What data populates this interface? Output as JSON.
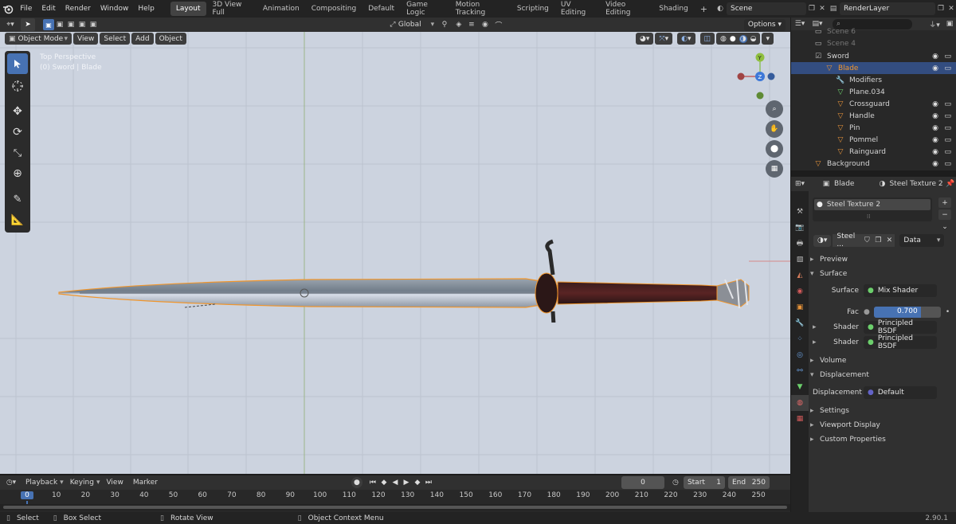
{
  "topbar": {
    "menus": [
      "File",
      "Edit",
      "Render",
      "Window",
      "Help"
    ],
    "workspaces": [
      "Layout",
      "3D View Full",
      "Animation",
      "Compositing",
      "Default",
      "Game Logic",
      "Motion Tracking",
      "Scripting",
      "UV Editing",
      "Video Editing",
      "Shading"
    ],
    "active_workspace": "Layout",
    "add_workspace": "+",
    "scene": "Scene",
    "view_layer": "RenderLayer"
  },
  "viewport_header": {
    "transform_orientation": "Global",
    "options": "Options",
    "mode": "Object Mode",
    "menus": [
      "View",
      "Select",
      "Add",
      "Object"
    ]
  },
  "viewport": {
    "view_name": "Top Perspective",
    "object_info": "(0) Sword | Blade",
    "gizmo_y": "Y",
    "gizmo_z": "Z"
  },
  "outliner": {
    "rows": [
      {
        "name": "Scene 6",
        "indent": 1
      },
      {
        "name": "Scene 4",
        "indent": 1
      },
      {
        "name": "Sword",
        "indent": 1
      },
      {
        "name": "Blade",
        "indent": 2
      },
      {
        "name": "Modifiers",
        "indent": 3
      },
      {
        "name": "Plane.034",
        "indent": 3
      },
      {
        "name": "Crossguard",
        "indent": 3
      },
      {
        "name": "Handle",
        "indent": 3
      },
      {
        "name": "Pin",
        "indent": 3
      },
      {
        "name": "Pommel",
        "indent": 3
      },
      {
        "name": "Rainguard",
        "indent": 3
      },
      {
        "name": "Background",
        "indent": 1
      }
    ]
  },
  "properties": {
    "object": "Blade",
    "material": "Steel Texture 2",
    "slot_name": "Steel Texture 2",
    "mat_short": "Steel ...",
    "link": "Data",
    "sections": {
      "preview": "Preview",
      "surface": "Surface",
      "volume": "Volume",
      "displacement": "Displacement",
      "settings": "Settings",
      "viewport_display": "Viewport Display",
      "custom_props": "Custom Properties"
    },
    "surface_label": "Surface",
    "surface_value": "Mix Shader",
    "fac_label": "Fac",
    "fac_value": "0.700",
    "fac_fraction": 0.7,
    "shader_label": "Shader",
    "shader1": "Principled BSDF",
    "shader2": "Principled BSDF",
    "disp_label": "Displacement",
    "disp_value": "Default"
  },
  "timeline": {
    "menus": [
      "Playback",
      "Keying",
      "View",
      "Marker"
    ],
    "current_frame": "0",
    "start_label": "Start",
    "start": "1",
    "end_label": "End",
    "end": "250",
    "ticks": [
      "0",
      "10",
      "20",
      "30",
      "40",
      "50",
      "60",
      "70",
      "80",
      "90",
      "100",
      "110",
      "120",
      "130",
      "140",
      "150",
      "160",
      "170",
      "180",
      "190",
      "200",
      "210",
      "220",
      "230",
      "240",
      "250"
    ]
  },
  "status": {
    "select": "Select",
    "box_select": "Box Select",
    "rotate": "Rotate View",
    "context": "Object Context Menu",
    "version": "2.90.1"
  },
  "colors": {
    "accent": "#4772b3",
    "selection_orange": "#f0962d",
    "viewport_bg": "#ccd3df"
  }
}
